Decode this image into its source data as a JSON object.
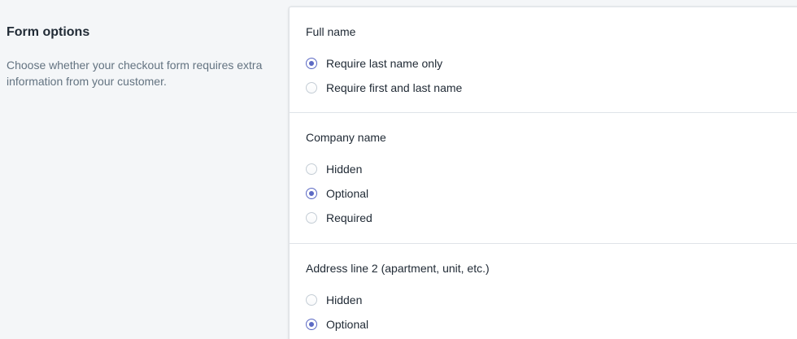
{
  "intro": {
    "title": "Form options",
    "description": "Choose whether your checkout form requires extra information from your customer."
  },
  "colors": {
    "accent": "#5c6ac4",
    "background": "#f4f6f8",
    "card": "#ffffff",
    "border": "#dfe3e8"
  },
  "sections": [
    {
      "title": "Full name",
      "options": [
        {
          "label": "Require last name only",
          "checked": true
        },
        {
          "label": "Require first and last name",
          "checked": false
        }
      ]
    },
    {
      "title": "Company name",
      "options": [
        {
          "label": "Hidden",
          "checked": false
        },
        {
          "label": "Optional",
          "checked": true
        },
        {
          "label": "Required",
          "checked": false
        }
      ]
    },
    {
      "title": "Address line 2 (apartment, unit, etc.)",
      "options": [
        {
          "label": "Hidden",
          "checked": false
        },
        {
          "label": "Optional",
          "checked": true
        }
      ]
    }
  ]
}
